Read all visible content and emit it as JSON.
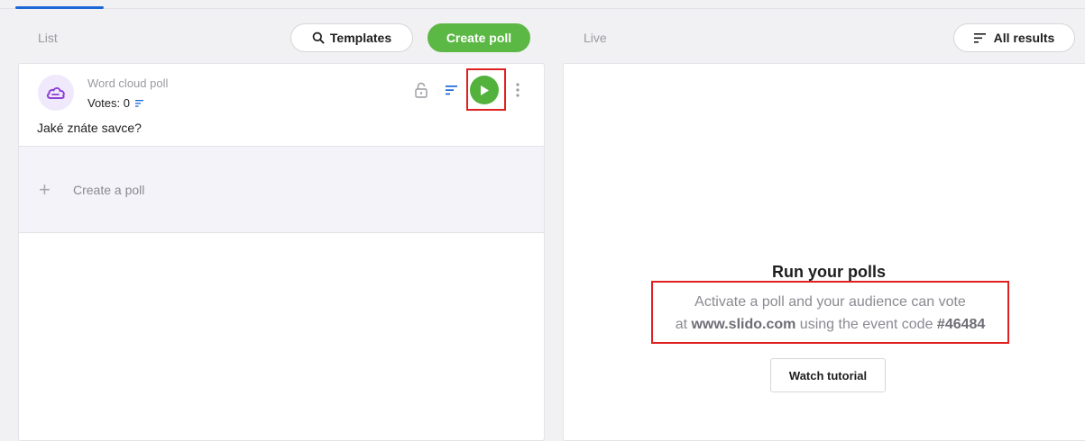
{
  "header": {
    "list_label": "List",
    "templates_label": "Templates",
    "create_poll_label": "Create poll",
    "live_label": "Live",
    "all_results_label": "All results"
  },
  "poll": {
    "type": "Word cloud poll",
    "votes": "Votes: 0",
    "question": "Jaké znáte savce?",
    "icon": "word-cloud-icon",
    "accent": "#8a3fd6"
  },
  "create_row": {
    "label": "Create a poll"
  },
  "live_panel": {
    "title": "Run your polls",
    "line1": "Activate a poll and your audience can vote",
    "line2_prefix": "at ",
    "site": "www.slido.com",
    "line2_middle": " using the event code ",
    "event_code": "#46484",
    "tutorial_label": "Watch tutorial"
  },
  "colors": {
    "green": "#5cb845",
    "blue": "#1b67d6",
    "highlight": "#e02020"
  }
}
